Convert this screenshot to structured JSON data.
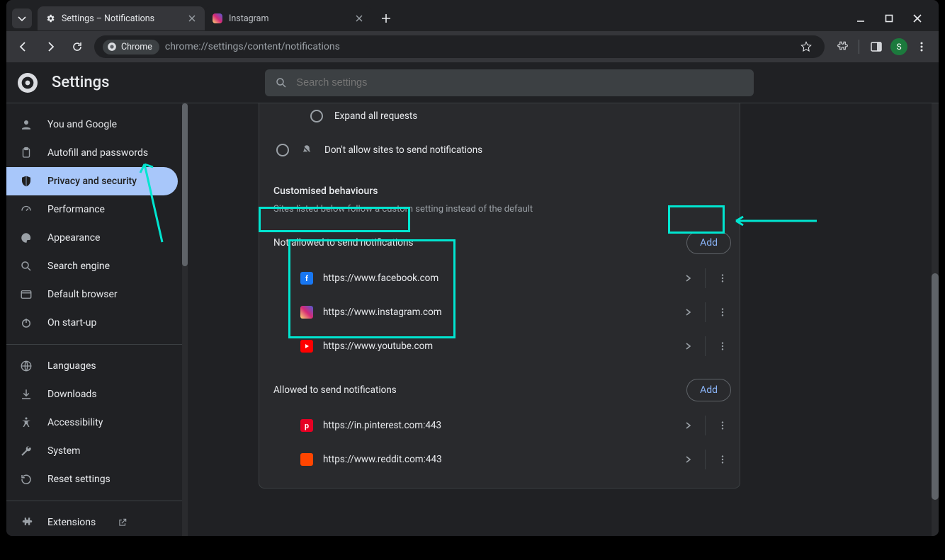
{
  "tabs": [
    {
      "title": "Settings – Notifications",
      "active": true,
      "icon": "gear"
    },
    {
      "title": "Instagram",
      "active": false,
      "icon": "ig"
    }
  ],
  "omnibox": {
    "chip": "Chrome",
    "url": "chrome://settings/content/notifications"
  },
  "profile_letter": "S",
  "header": {
    "title": "Settings",
    "search_placeholder": "Search settings"
  },
  "sidebar": {
    "groups": [
      {
        "items": [
          {
            "label": "You and Google",
            "icon": "person"
          },
          {
            "label": "Autofill and passwords",
            "icon": "clipboard"
          },
          {
            "label": "Privacy and security",
            "icon": "shield",
            "active": true
          },
          {
            "label": "Performance",
            "icon": "speed"
          },
          {
            "label": "Appearance",
            "icon": "palette"
          },
          {
            "label": "Search engine",
            "icon": "search"
          },
          {
            "label": "Default browser",
            "icon": "browser"
          },
          {
            "label": "On start-up",
            "icon": "power"
          }
        ]
      },
      {
        "items": [
          {
            "label": "Languages",
            "icon": "globe"
          },
          {
            "label": "Downloads",
            "icon": "download"
          },
          {
            "label": "Accessibility",
            "icon": "access"
          },
          {
            "label": "System",
            "icon": "wrench"
          },
          {
            "label": "Reset settings",
            "icon": "reset"
          }
        ]
      },
      {
        "items": [
          {
            "label": "Extensions",
            "icon": "puzzle",
            "external": true
          }
        ]
      }
    ]
  },
  "main": {
    "radios": [
      {
        "label": "Expand all requests",
        "indent": true
      },
      {
        "label": "Don't allow sites to send notifications",
        "muted_icon": true
      }
    ],
    "custom_heading": "Customised behaviours",
    "custom_sub": "Sites listed below follow a custom setting instead of the default",
    "blocked_label": "Not allowed to send notifications",
    "allowed_label": "Allowed to send notifications",
    "add_label": "Add",
    "blocked_sites": [
      {
        "url": "https://www.facebook.com",
        "kind": "fb"
      },
      {
        "url": "https://www.instagram.com",
        "kind": "ig"
      },
      {
        "url": "https://www.youtube.com",
        "kind": "yt"
      }
    ],
    "allowed_sites": [
      {
        "url": "https://in.pinterest.com:443",
        "kind": "pin"
      },
      {
        "url": "https://www.reddit.com:443",
        "kind": "rd"
      }
    ]
  }
}
